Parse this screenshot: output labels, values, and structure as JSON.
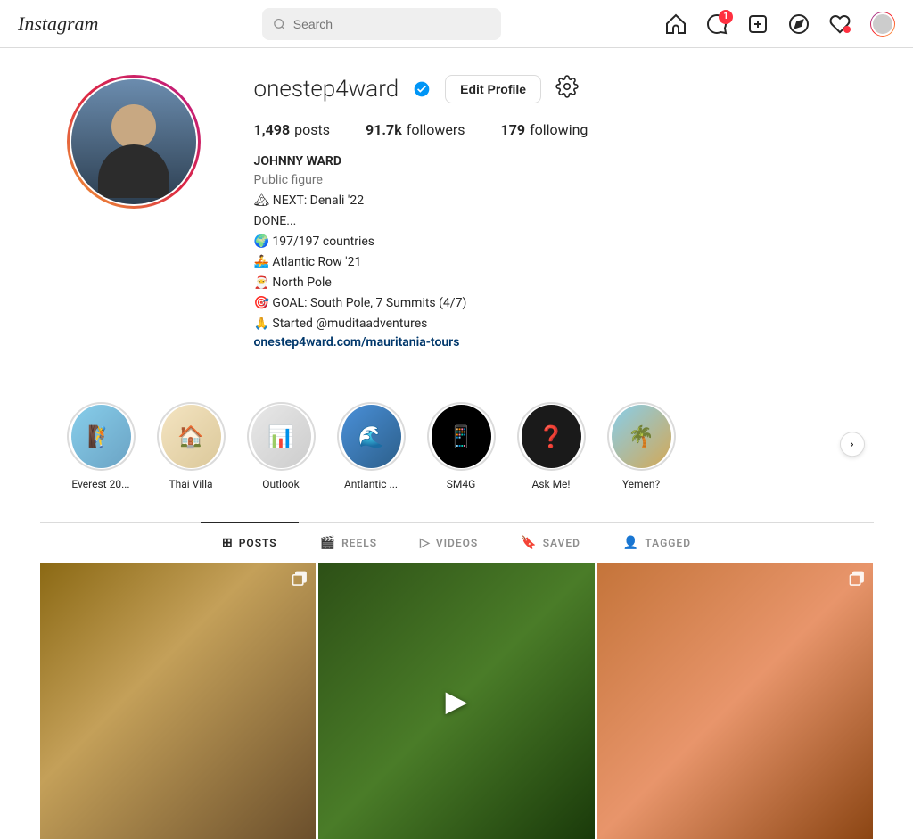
{
  "header": {
    "logo": "Instagram",
    "search_placeholder": "Search",
    "icons": {
      "home": "🏠",
      "messages": "💬",
      "messages_badge": "1",
      "create": "➕",
      "explore": "🧭",
      "likes": "♡",
      "likes_dot": true
    }
  },
  "profile": {
    "username": "onestep4ward",
    "verified": true,
    "edit_button": "Edit Profile",
    "stats": {
      "posts_value": "1,498",
      "posts_label": "posts",
      "followers_value": "91.7k",
      "followers_label": "followers",
      "following_value": "179",
      "following_label": "following"
    },
    "bio": {
      "name": "JOHNNY WARD",
      "role": "Public figure",
      "line1": "🏔 NEXT: Denali '22",
      "line2": "DONE...",
      "line3": "🌍 197/197 countries",
      "line4": "🚣 Atlantic Row '21",
      "line5": "🎅 North Pole",
      "line6": "🎯 GOAL: South Pole, 7 Summits (4/7)",
      "line7": "🙏 Started @muditaadventures",
      "link": "onestep4ward.com/mauritania-tours"
    }
  },
  "highlights": [
    {
      "id": 1,
      "label": "Everest 20...",
      "bg": "highlight-bg-1",
      "emoji": "🧗"
    },
    {
      "id": 2,
      "label": "Thai Villa",
      "bg": "highlight-bg-2",
      "emoji": "🏠"
    },
    {
      "id": 3,
      "label": "Outlook",
      "bg": "highlight-bg-3",
      "emoji": "📊"
    },
    {
      "id": 4,
      "label": "Antlantic ...",
      "bg": "highlight-bg-4",
      "emoji": "🌊"
    },
    {
      "id": 5,
      "label": "SM4G",
      "bg": "highlight-bg-5",
      "emoji": "📱"
    },
    {
      "id": 6,
      "label": "Ask Me!",
      "bg": "highlight-bg-6",
      "emoji": "❓"
    },
    {
      "id": 7,
      "label": "Yemen?",
      "bg": "highlight-bg-7",
      "emoji": "🌴"
    }
  ],
  "tabs": [
    {
      "id": "posts",
      "label": "POSTS",
      "icon": "⊞",
      "active": true
    },
    {
      "id": "reels",
      "label": "REELS",
      "icon": "🎬"
    },
    {
      "id": "videos",
      "label": "VIDEOS",
      "icon": "▷"
    },
    {
      "id": "saved",
      "label": "SAVED",
      "icon": "🔖"
    },
    {
      "id": "tagged",
      "label": "TAGGED",
      "icon": "👤"
    }
  ],
  "posts": [
    {
      "id": 1,
      "type": "multi",
      "bg": "post-1"
    },
    {
      "id": 2,
      "type": "video",
      "bg": "post-2"
    },
    {
      "id": 3,
      "type": "multi",
      "bg": "post-3"
    }
  ]
}
